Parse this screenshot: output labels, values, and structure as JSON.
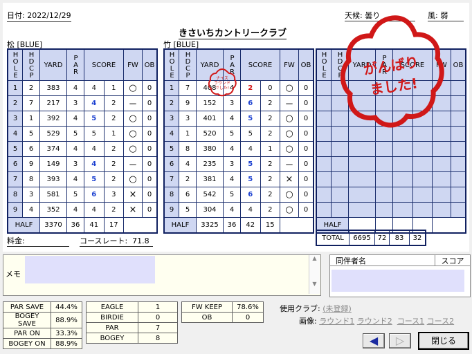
{
  "header": {
    "date": "日付: 2022/12/29",
    "weather_label": "天候: ",
    "weather_value": "曇り",
    "wind_label": "風: ",
    "wind_value": "弱",
    "course_name": "きさいちカントリークラブ"
  },
  "stamp_small": {
    "line1": "ナイス",
    "line2": "ラウンド",
    "line3": "でした!"
  },
  "stamp_big": {
    "line1": "がんばり",
    "line2": "ました!"
  },
  "columns": {
    "hole": "HOLE",
    "hdcp": "HDCP",
    "yard": "YARD",
    "par": "PAR",
    "score": "SCORE",
    "fw": "FW",
    "ob": "OB"
  },
  "front": {
    "tee": "松 [BLUE]",
    "rows": [
      {
        "hole": "1",
        "hdcp": "2",
        "yard": "383",
        "par": "4",
        "strokes": "4",
        "putts": "1",
        "fw": "○",
        "ob": "0",
        "t": "par"
      },
      {
        "hole": "2",
        "hdcp": "7",
        "yard": "217",
        "par": "3",
        "strokes": "4",
        "putts": "2",
        "fw": "－",
        "ob": "0",
        "t": "bogey"
      },
      {
        "hole": "3",
        "hdcp": "1",
        "yard": "392",
        "par": "4",
        "strokes": "5",
        "putts": "2",
        "fw": "○",
        "ob": "0",
        "t": "bogey"
      },
      {
        "hole": "4",
        "hdcp": "5",
        "yard": "529",
        "par": "5",
        "strokes": "5",
        "putts": "1",
        "fw": "○",
        "ob": "0",
        "t": "par"
      },
      {
        "hole": "5",
        "hdcp": "6",
        "yard": "374",
        "par": "4",
        "strokes": "4",
        "putts": "2",
        "fw": "○",
        "ob": "0",
        "t": "par"
      },
      {
        "hole": "6",
        "hdcp": "9",
        "yard": "149",
        "par": "3",
        "strokes": "4",
        "putts": "2",
        "fw": "－",
        "ob": "0",
        "t": "bogey"
      },
      {
        "hole": "7",
        "hdcp": "8",
        "yard": "393",
        "par": "4",
        "strokes": "5",
        "putts": "2",
        "fw": "○",
        "ob": "0",
        "t": "bogey"
      },
      {
        "hole": "8",
        "hdcp": "3",
        "yard": "581",
        "par": "5",
        "strokes": "6",
        "putts": "3",
        "fw": "×",
        "ob": "0",
        "t": "bogey"
      },
      {
        "hole": "9",
        "hdcp": "4",
        "yard": "352",
        "par": "4",
        "strokes": "4",
        "putts": "2",
        "fw": "×",
        "ob": "0",
        "t": "par"
      }
    ],
    "half": {
      "label": "HALF",
      "yard": "3370",
      "par": "36",
      "strokes": "41",
      "putts": "17"
    }
  },
  "back": {
    "tee": "竹 [BLUE]",
    "rows": [
      {
        "hole": "1",
        "hdcp": "7",
        "yard": "408",
        "par": "4",
        "strokes": "2",
        "putts": "0",
        "fw": "○",
        "ob": "0",
        "t": "eagle"
      },
      {
        "hole": "2",
        "hdcp": "9",
        "yard": "152",
        "par": "3",
        "strokes": "6",
        "putts": "2",
        "fw": "－",
        "ob": "0",
        "t": "triple"
      },
      {
        "hole": "3",
        "hdcp": "3",
        "yard": "401",
        "par": "4",
        "strokes": "5",
        "putts": "2",
        "fw": "○",
        "ob": "0",
        "t": "bogey"
      },
      {
        "hole": "4",
        "hdcp": "1",
        "yard": "520",
        "par": "5",
        "strokes": "5",
        "putts": "2",
        "fw": "○",
        "ob": "0",
        "t": "par"
      },
      {
        "hole": "5",
        "hdcp": "8",
        "yard": "380",
        "par": "4",
        "strokes": "4",
        "putts": "1",
        "fw": "○",
        "ob": "0",
        "t": "par"
      },
      {
        "hole": "6",
        "hdcp": "4",
        "yard": "235",
        "par": "3",
        "strokes": "5",
        "putts": "2",
        "fw": "－",
        "ob": "0",
        "t": "double"
      },
      {
        "hole": "7",
        "hdcp": "2",
        "yard": "381",
        "par": "4",
        "strokes": "5",
        "putts": "2",
        "fw": "×",
        "ob": "0",
        "t": "bogey"
      },
      {
        "hole": "8",
        "hdcp": "6",
        "yard": "542",
        "par": "5",
        "strokes": "6",
        "putts": "2",
        "fw": "○",
        "ob": "0",
        "t": "bogey"
      },
      {
        "hole": "9",
        "hdcp": "5",
        "yard": "304",
        "par": "4",
        "strokes": "4",
        "putts": "2",
        "fw": "○",
        "ob": "0",
        "t": "par"
      }
    ],
    "half": {
      "label": "HALF",
      "yard": "3325",
      "par": "36",
      "strokes": "42",
      "putts": "15"
    }
  },
  "third": {
    "half_label": "HALF"
  },
  "total": {
    "label": "TOTAL",
    "yard": "6695",
    "par": "72",
    "strokes": "83",
    "putts": "32"
  },
  "fee_label": "料金:",
  "rating": {
    "label": "コースレート:",
    "value": "71.8"
  },
  "memo_label": "メモ",
  "companion": {
    "name_header": "同伴者名",
    "score_header": "スコア"
  },
  "stats1": [
    {
      "label": "PAR SAVE",
      "value": "44.4%"
    },
    {
      "label": "BOGEY SAVE",
      "value": "88.9%"
    },
    {
      "label": "PAR ON",
      "value": "33.3%"
    },
    {
      "label": "BOGEY ON",
      "value": "88.9%"
    }
  ],
  "stats2": [
    {
      "label": "EAGLE",
      "value": "1"
    },
    {
      "label": "BIRDIE",
      "value": "0"
    },
    {
      "label": "PAR",
      "value": "7"
    },
    {
      "label": "BOGEY",
      "value": "8"
    }
  ],
  "stats3": [
    {
      "label": "FW KEEP",
      "value": "78.6%"
    },
    {
      "label": "OB",
      "value": "0"
    }
  ],
  "club": {
    "label": "使用クラブ:",
    "value": "(未登録)"
  },
  "images": {
    "label": "画像:",
    "r1": "ラウンド1",
    "r2": "ラウンド2",
    "c1": "コース1",
    "c2": "コース2"
  },
  "buttons": {
    "close": "閉じる"
  },
  "colors": {
    "grid": "#1a2d6c",
    "header_fill": "#cfd7f2",
    "stamp": "#d01818",
    "birdie_blue": "#1a3fd0"
  }
}
